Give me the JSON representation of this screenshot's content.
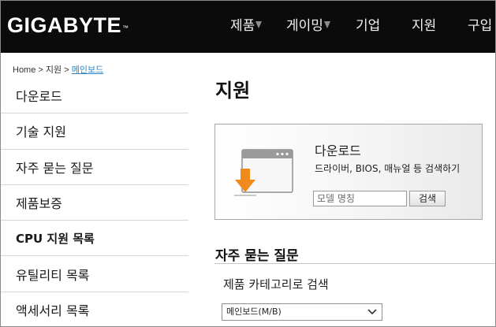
{
  "header": {
    "logo": "GIGABYTE",
    "logo_tm": "™",
    "nav": [
      {
        "label": "제품",
        "has_menu": true
      },
      {
        "label": "게이밍",
        "has_menu": true
      },
      {
        "label": "기업",
        "has_menu": false
      },
      {
        "label": "지원",
        "has_menu": false
      },
      {
        "label": "구입",
        "has_menu": false
      }
    ]
  },
  "breadcrumb": {
    "home": "Home",
    "sep1": ">",
    "support": "지원",
    "sep2": ">",
    "current": "메인보드"
  },
  "sidebar": {
    "items": [
      {
        "label": "다운로드"
      },
      {
        "label": "기술 지원"
      },
      {
        "label": "자주 묻는 질문"
      },
      {
        "label": "제품보증"
      },
      {
        "label": "CPU 지원 목록"
      },
      {
        "label": "유틸리티 목록"
      },
      {
        "label": "액세서리 목록"
      }
    ]
  },
  "main": {
    "title": "지원",
    "download": {
      "title": "다운로드",
      "description": "드라이버, BIOS, 매뉴얼 등 검색하기",
      "search_placeholder": "모델 명칭",
      "search_button": "검색"
    },
    "faq": {
      "title": "자주 묻는 질문",
      "subtitle": "제품 카테고리로 검색",
      "selected_category": "메인보드(M/B)"
    }
  },
  "colors": {
    "header_bg": "#0b0b0b",
    "link": "#2a86c6",
    "download_arrow": "#f08a1c"
  }
}
